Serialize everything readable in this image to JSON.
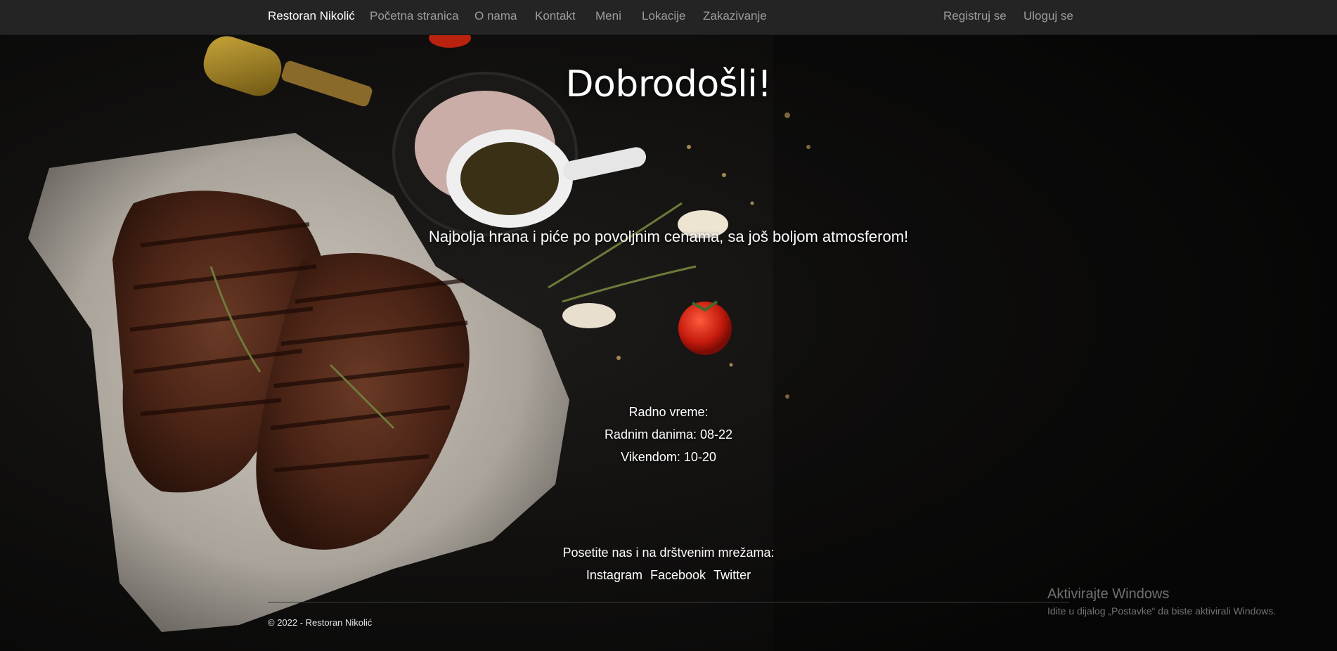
{
  "navbar": {
    "brand": "Restoran Nikolić",
    "links": [
      "Početna stranica",
      "O nama",
      "Kontakt",
      "Meni",
      "Lokacije",
      "Zakazivanje"
    ],
    "right_links": [
      "Registruj se",
      "Uloguj se"
    ]
  },
  "hero": {
    "title": "Dobrodošli!",
    "subtitle": "Najbolja hrana i piće po povoljnim cenama, sa još boljom atmosferom!"
  },
  "hours": {
    "label": "Radno vreme:",
    "weekdays": "Radnim danima: 08-22",
    "weekend": "Vikendom: 10-20"
  },
  "social": {
    "title": "Posetite nas i na drštvenim mrežama:",
    "links": [
      "Instagram",
      "Facebook",
      "Twitter"
    ]
  },
  "footer": {
    "text": "© 2022 - Restoran Nikolić"
  },
  "watermark": {
    "title": "Aktivirajte Windows",
    "subtitle": "Idite u dijalog „Postavke“ da biste aktivirali Windows."
  },
  "colors": {
    "navbar_bg": "#242424",
    "nav_link": "#9d9d9d",
    "brand": "#ffffff",
    "background": "#0c0b0a"
  }
}
